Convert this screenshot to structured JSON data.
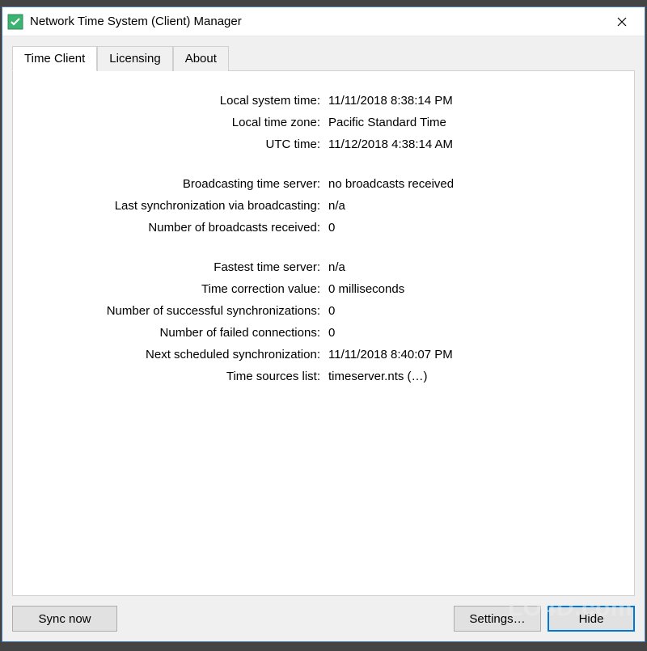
{
  "window": {
    "title": "Network Time System (Client) Manager"
  },
  "tabs": [
    {
      "label": "Time Client"
    },
    {
      "label": "Licensing"
    },
    {
      "label": "About"
    }
  ],
  "rows": {
    "local_system_time": {
      "label": "Local system time:",
      "value": "11/11/2018 8:38:14 PM"
    },
    "local_time_zone": {
      "label": "Local time zone:",
      "value": "Pacific Standard Time"
    },
    "utc_time": {
      "label": "UTC time:",
      "value": "11/12/2018 4:38:14 AM"
    },
    "broadcast_server": {
      "label": "Broadcasting time server:",
      "value": "no broadcasts received"
    },
    "last_sync_broadcast": {
      "label": "Last synchronization via broadcasting:",
      "value": "n/a"
    },
    "broadcasts_received": {
      "label": "Number of broadcasts received:",
      "value": "0"
    },
    "fastest_server": {
      "label": "Fastest time server:",
      "value": "n/a"
    },
    "correction_value": {
      "label": "Time correction value:",
      "value": "0 milliseconds"
    },
    "successful_syncs": {
      "label": "Number of successful synchronizations:",
      "value": "0"
    },
    "failed_connections": {
      "label": "Number of failed connections:",
      "value": "0"
    },
    "next_sync": {
      "label": "Next scheduled synchronization:",
      "value": "11/11/2018 8:40:07 PM"
    },
    "sources_list": {
      "label": "Time sources list:",
      "value": "timeserver.nts (…)"
    }
  },
  "buttons": {
    "sync": "Sync now",
    "settings": "Settings…",
    "hide": "Hide"
  },
  "watermark": "LO4D.com"
}
